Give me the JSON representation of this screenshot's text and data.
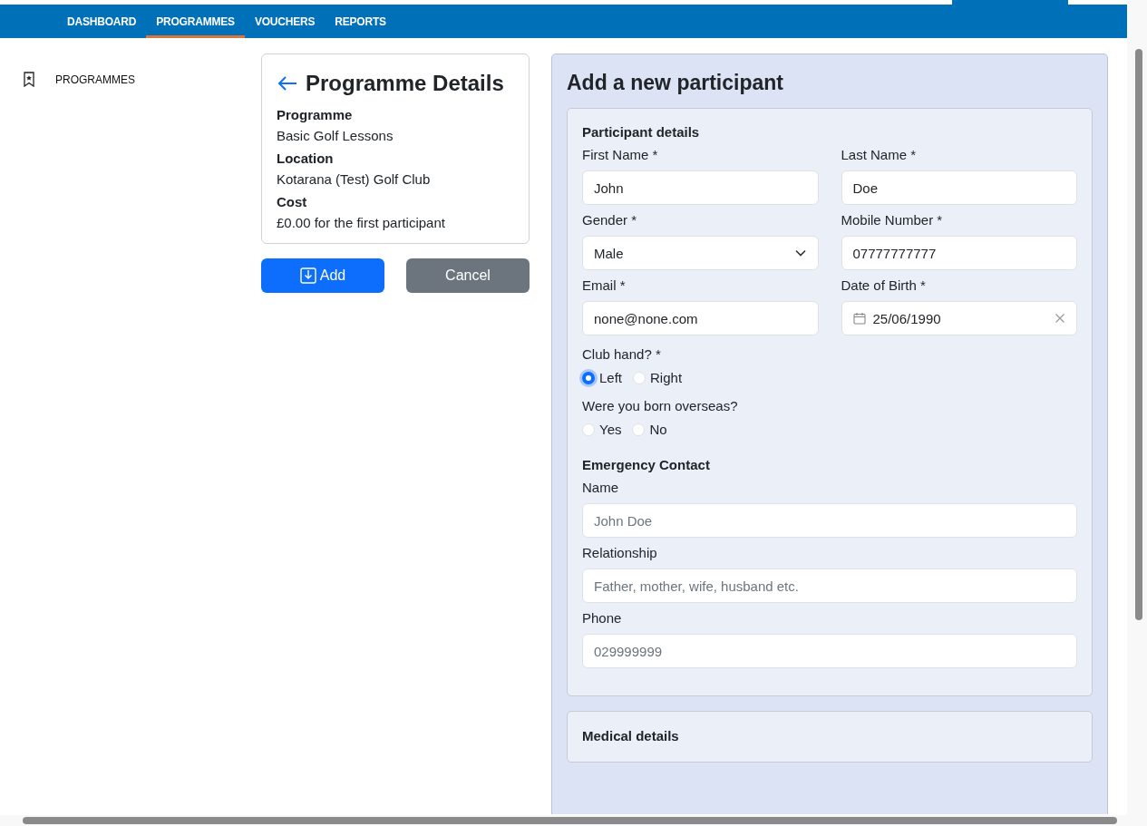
{
  "nav": [
    {
      "label": "DASHBOARD",
      "selected": false
    },
    {
      "label": "PROGRAMMES",
      "selected": true
    },
    {
      "label": "VOUCHERS",
      "selected": false
    },
    {
      "label": "REPORTS",
      "selected": false
    }
  ],
  "sidebar": {
    "items": [
      {
        "label": "PROGRAMMES"
      }
    ]
  },
  "programme": {
    "title": "Programme Details",
    "fields": [
      {
        "label": "Programme",
        "value": "Basic Golf Lessons"
      },
      {
        "label": "Location",
        "value": "Kotarana (Test) Golf Club"
      },
      {
        "label": "Cost",
        "value": "£0.00 for the first participant"
      }
    ],
    "actions": [
      {
        "label": "Add",
        "kind": "primary"
      },
      {
        "label": "Cancel",
        "kind": "secondary"
      }
    ]
  },
  "form": {
    "title": "Add a new participant",
    "participant": {
      "heading": "Participant details",
      "fields": [
        {
          "label": "First Name *",
          "kind": "text",
          "value": "John"
        },
        {
          "label": "Last Name *",
          "kind": "text",
          "value": "Doe"
        },
        {
          "label": "Gender *",
          "kind": "select",
          "value": "Male"
        },
        {
          "label": "Mobile Number *",
          "kind": "text",
          "value": "07777777777"
        },
        {
          "label": "Email *",
          "kind": "text",
          "value": "none@none.com"
        },
        {
          "label": "Date of Birth *",
          "kind": "date",
          "value": "25/06/1990"
        }
      ],
      "radio_groups": [
        {
          "label": "Club hand? *",
          "options": [
            {
              "label": "Left",
              "selected": true
            },
            {
              "label": "Right",
              "selected": false
            }
          ]
        },
        {
          "label": "Were you born overseas?",
          "options": [
            {
              "label": "Yes",
              "selected": false
            },
            {
              "label": "No",
              "selected": false
            }
          ]
        }
      ]
    },
    "emergency": {
      "heading": "Emergency Contact",
      "fields": [
        {
          "label": "Name",
          "placeholder": "John Doe"
        },
        {
          "label": "Relationship",
          "placeholder": "Father, mother, wife, husband etc."
        },
        {
          "label": "Phone",
          "placeholder": "029999999"
        }
      ]
    },
    "medical": {
      "heading": "Medical details"
    }
  }
}
